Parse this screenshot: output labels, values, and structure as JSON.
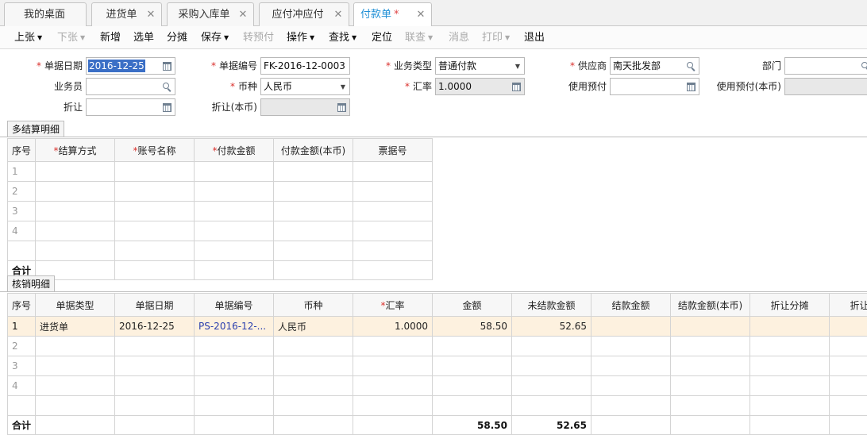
{
  "tabs": [
    {
      "label": "我的桌面",
      "closable": false
    },
    {
      "label": "进货单",
      "closable": true
    },
    {
      "label": "采购入库单",
      "closable": true
    },
    {
      "label": "应付冲应付",
      "closable": true
    },
    {
      "label": "付款单",
      "closable": true,
      "modified": "*",
      "active": true
    }
  ],
  "toolbar": [
    {
      "label": "上张",
      "dropdown": true,
      "enabled": true
    },
    {
      "label": "下张",
      "dropdown": true,
      "enabled": false
    },
    {
      "label": "新增",
      "enabled": true
    },
    {
      "label": "选单",
      "enabled": true
    },
    {
      "label": "分摊",
      "enabled": true
    },
    {
      "label": "保存",
      "dropdown": true,
      "enabled": true
    },
    {
      "label": "转预付",
      "enabled": false
    },
    {
      "label": "操作",
      "dropdown": true,
      "enabled": true
    },
    {
      "label": "查找",
      "dropdown": true,
      "enabled": true
    },
    {
      "label": "定位",
      "enabled": true
    },
    {
      "label": "联查",
      "dropdown": true,
      "enabled": false
    },
    {
      "label": "消息",
      "enabled": false
    },
    {
      "label": "打印",
      "dropdown": true,
      "enabled": false
    },
    {
      "label": "退出",
      "enabled": true
    }
  ],
  "form": {
    "doc_date": {
      "label": "单据日期",
      "value": "2016-12-25",
      "required": true
    },
    "doc_no": {
      "label": "单据编号",
      "value": "FK-2016-12-0003",
      "required": true
    },
    "biz_type": {
      "label": "业务类型",
      "value": "普通付款",
      "required": true
    },
    "supplier": {
      "label": "供应商",
      "value": "南天批发部",
      "required": true
    },
    "dept": {
      "label": "部门",
      "value": ""
    },
    "salesman": {
      "label": "业务员",
      "value": ""
    },
    "currency": {
      "label": "币种",
      "value": "人民币",
      "required": true
    },
    "rate": {
      "label": "汇率",
      "value": "1.0000",
      "required": true
    },
    "use_prepay": {
      "label": "使用预付",
      "value": ""
    },
    "use_prepay_local": {
      "label": "使用预付(本币)",
      "value": ""
    },
    "discount": {
      "label": "折让",
      "value": ""
    },
    "discount_local": {
      "label": "折让(本币)",
      "value": ""
    }
  },
  "settlement": {
    "tab_label": "多结算明细",
    "columns": [
      {
        "label": "序号",
        "required": false
      },
      {
        "label": "结算方式",
        "required": true
      },
      {
        "label": "账号名称",
        "required": true
      },
      {
        "label": "付款金额",
        "required": true
      },
      {
        "label": "付款金额(本币)",
        "required": false
      },
      {
        "label": "票据号",
        "required": false
      }
    ],
    "row_numbers": [
      "1",
      "2",
      "3",
      "4"
    ],
    "total_label": "合计"
  },
  "writeoff": {
    "tab_label": "核销明细",
    "columns": [
      {
        "label": "序号",
        "required": false
      },
      {
        "label": "单据类型",
        "required": false
      },
      {
        "label": "单据日期",
        "required": false
      },
      {
        "label": "单据编号",
        "required": false
      },
      {
        "label": "币种",
        "required": false
      },
      {
        "label": "汇率",
        "required": true
      },
      {
        "label": "金额",
        "required": false
      },
      {
        "label": "未结款金额",
        "required": false
      },
      {
        "label": "结款金额",
        "required": false
      },
      {
        "label": "结款金额(本币)",
        "required": false
      },
      {
        "label": "折让分摊",
        "required": false
      },
      {
        "label": "折让分摊",
        "required": false
      }
    ],
    "rows": [
      {
        "no": "1",
        "doc_type": "进货单",
        "date": "2016-12-25",
        "doc_no": "PS-2016-12-...",
        "currency": "人民币",
        "rate": "1.0000",
        "amount": "58.50",
        "unsettled": "52.65",
        "settle": "",
        "settle_local": "",
        "disc": "",
        "disc2": ""
      }
    ],
    "empty_row_numbers": [
      "2",
      "3",
      "4"
    ],
    "total_label": "合计",
    "total_amount": "58.50",
    "total_unsettled": "52.65"
  }
}
